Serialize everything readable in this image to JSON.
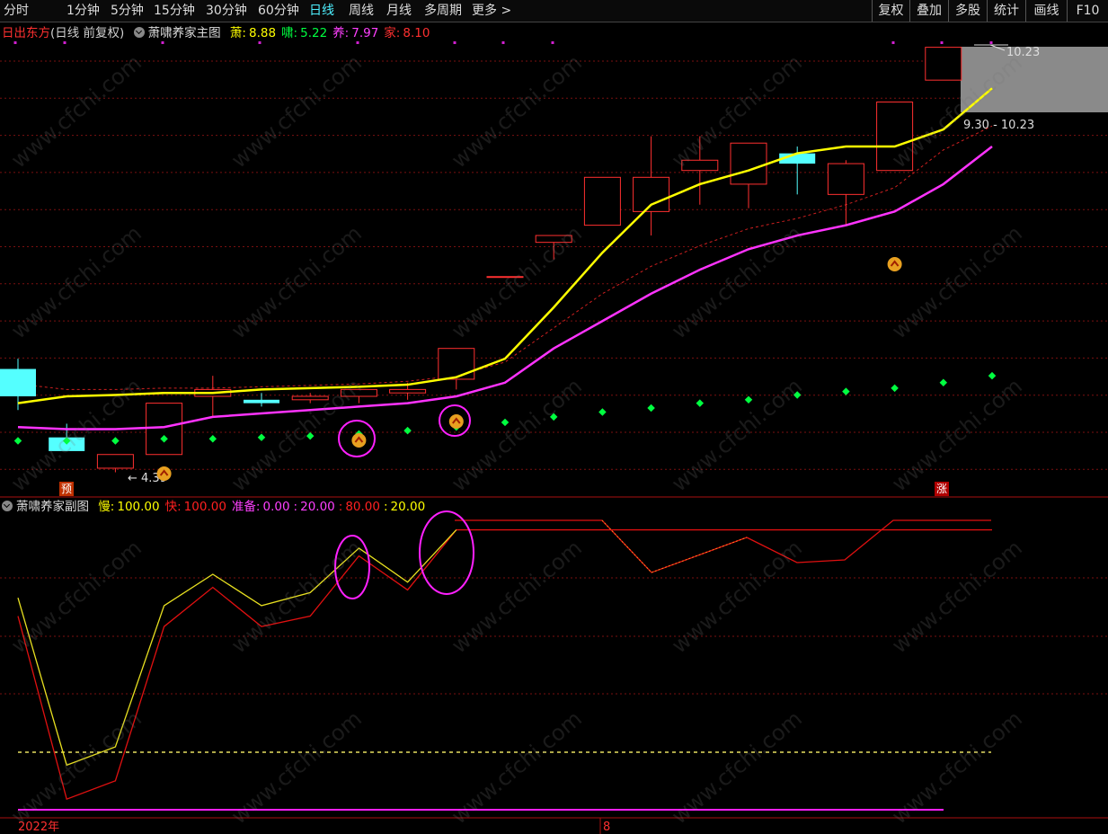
{
  "toolbar": {
    "periods": [
      "分时",
      "1分钟",
      "5分钟",
      "15分钟",
      "30分钟",
      "60分钟",
      "日线",
      "周线",
      "月线",
      "多周期",
      "更多 >"
    ],
    "active_period": "日线",
    "right_buttons": [
      "复权",
      "叠加",
      "多股",
      "统计",
      "画线",
      "F10"
    ]
  },
  "main_header": {
    "stock_name": "日出东方",
    "mode": "(日线 前复权)",
    "indicator": "萧啸养家主图",
    "values": [
      {
        "label": "萧:",
        "value": "8.88",
        "color": "#ffff00"
      },
      {
        "label": "啸:",
        "value": "5.22",
        "color": "#00ff40"
      },
      {
        "label": "养:",
        "value": "7.97",
        "color": "#ff40ff"
      },
      {
        "label": "家:",
        "value": "8.10",
        "color": "#ff3030"
      }
    ]
  },
  "sub_header": {
    "indicator": "萧啸养家副图",
    "values": [
      {
        "label": "慢:",
        "value": "100.00",
        "color": "#ffff00"
      },
      {
        "label": "快:",
        "value": "100.00",
        "color": "#ff2020"
      },
      {
        "label": "准备:",
        "value": "0.00",
        "color": "#ff40ff"
      },
      {
        "label": ":",
        "value": "20.00",
        "color": "#ff40ff"
      },
      {
        "label": ":",
        "value": "80.00",
        "color": "#ff2020"
      },
      {
        "label": ":",
        "value": "20.00",
        "color": "#ffff00"
      }
    ]
  },
  "annotations": {
    "high_label": "10.23",
    "range_label": "9.30 - 10.23",
    "low_label": "4.39",
    "pre_tag": "预",
    "rise_tag": "涨",
    "year_label": "2022年",
    "month_label": "8",
    "watermark": "www.cfchi.com"
  },
  "colors": {
    "up": "#ff3030",
    "down": "#54ffff",
    "ma_yellow": "#ffff00",
    "ma_magenta": "#ff33ff",
    "dots": "#00ff40",
    "grid": "#7a1010"
  },
  "chart_data": {
    "type": "candlestick",
    "y_range": [
      4.2,
      10.7
    ],
    "candles": [
      {
        "o": 5.9,
        "h": 6.05,
        "l": 5.3,
        "c": 5.5
      },
      {
        "o": 4.9,
        "h": 5.1,
        "l": 4.7,
        "c": 4.7
      },
      {
        "o": 4.45,
        "h": 4.65,
        "l": 4.39,
        "c": 4.65
      },
      {
        "o": 4.65,
        "h": 5.4,
        "l": 4.65,
        "c": 5.4
      },
      {
        "o": 5.5,
        "h": 5.8,
        "l": 5.2,
        "c": 5.6
      },
      {
        "o": 5.45,
        "h": 5.55,
        "l": 5.35,
        "c": 5.4
      },
      {
        "o": 5.45,
        "h": 5.55,
        "l": 5.4,
        "c": 5.5
      },
      {
        "o": 5.5,
        "h": 5.6,
        "l": 5.4,
        "c": 5.6
      },
      {
        "o": 5.55,
        "h": 5.7,
        "l": 5.45,
        "c": 5.6
      },
      {
        "o": 5.75,
        "h": 6.2,
        "l": 5.6,
        "c": 6.2
      },
      {
        "o": 7.25,
        "h": 7.25,
        "l": 7.25,
        "c": 7.25
      },
      {
        "o": 7.75,
        "h": 7.85,
        "l": 7.5,
        "c": 7.85
      },
      {
        "o": 8.0,
        "h": 8.7,
        "l": 8.0,
        "c": 8.7
      },
      {
        "o": 8.2,
        "h": 9.3,
        "l": 7.85,
        "c": 8.7
      },
      {
        "o": 8.8,
        "h": 9.3,
        "l": 8.3,
        "c": 8.95
      },
      {
        "o": 8.6,
        "h": 9.2,
        "l": 8.25,
        "c": 9.2
      },
      {
        "o": 9.05,
        "h": 9.15,
        "l": 8.45,
        "c": 8.9
      },
      {
        "o": 8.45,
        "h": 8.95,
        "l": 8.0,
        "c": 8.9
      },
      {
        "o": 8.8,
        "h": 9.8,
        "l": 8.8,
        "c": 9.8
      },
      {
        "o": 10.12,
        "h": 10.6,
        "l": 10.12,
        "c": 10.6
      }
    ],
    "ma_yellow": [
      5.4,
      5.5,
      5.52,
      5.55,
      5.55,
      5.6,
      5.62,
      5.64,
      5.67,
      5.78,
      6.05,
      6.8,
      7.6,
      8.3,
      8.6,
      8.8,
      9.05,
      9.15,
      9.15,
      9.4,
      10.0
    ],
    "ma_magenta": [
      5.05,
      5.02,
      5.02,
      5.05,
      5.2,
      5.25,
      5.3,
      5.35,
      5.4,
      5.5,
      5.7,
      6.2,
      6.6,
      7.0,
      7.35,
      7.65,
      7.85,
      8.0,
      8.2,
      8.6,
      9.15
    ],
    "ma_red_dashed": [
      5.68,
      5.6,
      5.6,
      5.62,
      5.62,
      5.64,
      5.66,
      5.68,
      5.72,
      5.8,
      6.0,
      6.5,
      7.0,
      7.4,
      7.7,
      7.95,
      8.1,
      8.3,
      8.55,
      9.1,
      9.45
    ],
    "dots": [
      4.85,
      4.85,
      4.85,
      4.88,
      4.88,
      4.9,
      4.92,
      4.95,
      5.0,
      5.05,
      5.12,
      5.2,
      5.27,
      5.33,
      5.4,
      5.45,
      5.52,
      5.57,
      5.62,
      5.7,
      5.8
    ],
    "arrow_up_idx": [
      3
    ],
    "arrow_buy_idx": [
      7,
      9,
      18
    ],
    "sub": {
      "y_range": [
        -5,
        105
      ],
      "slow": [
        74,
        10,
        17,
        71,
        83,
        71,
        76,
        93,
        80,
        100,
        100,
        100,
        100,
        100,
        100,
        100,
        100,
        100,
        100,
        100,
        100
      ],
      "fast": [
        67,
        -3,
        4,
        63,
        78,
        63,
        67,
        90,
        77,
        100,
        100,
        100,
        100,
        100,
        100,
        100,
        100,
        100,
        100,
        100,
        100
      ],
      "levels": [
        20,
        80
      ]
    }
  }
}
